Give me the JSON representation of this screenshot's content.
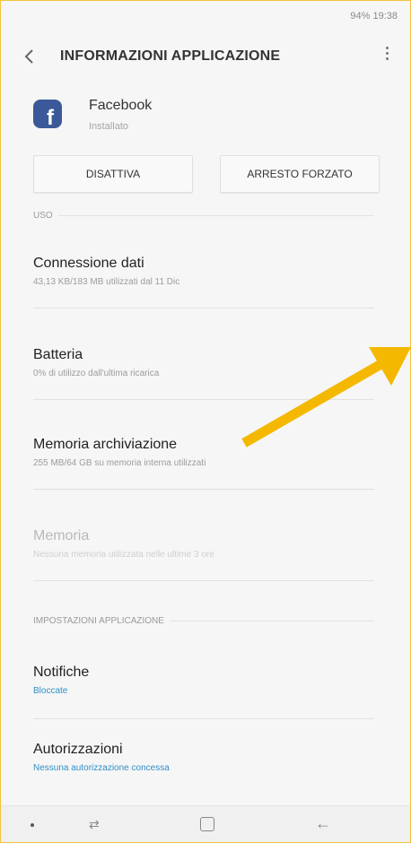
{
  "status_bar": {
    "text": "94% 19:38"
  },
  "app_bar": {
    "title": "INFORMAZIONI APPLICAZIONE",
    "back_icon": "chevron-left-icon",
    "menu_icon": "more-vertical-icon"
  },
  "app": {
    "name": "Facebook",
    "status": "Installato",
    "icon": "facebook-icon",
    "brand_color": "#3b5998"
  },
  "buttons": {
    "disable": "DISATTIVA",
    "force_stop": "ARRESTO FORZATO"
  },
  "sections": {
    "usage_header": "USO",
    "app_settings_header": "IMPOSTAZIONI APPLICAZIONE"
  },
  "usage_items": [
    {
      "title": "Connessione dati",
      "subtitle": "43,13 KB/183 MB utilizzati dal 11 Dic"
    },
    {
      "title": "Batteria",
      "subtitle": "0% di utilizzo dall'ultima ricarica"
    },
    {
      "title": "Memoria archiviazione",
      "subtitle": "255 MB/64 GB su memoria interna utilizzati"
    },
    {
      "title": "Memoria",
      "subtitle": "Nessuna memoria utilizzata nelle ultime 3 ore"
    }
  ],
  "settings_items": [
    {
      "title": "Notifiche",
      "subtitle": "Bloccate"
    },
    {
      "title": "Autorizzazioni",
      "subtitle": "Nessuna autorizzazione concessa"
    }
  ],
  "annotation": {
    "arrow_color": "#f5b800"
  },
  "colors": {
    "accent_blue": "#2f8fc6",
    "frame_border": "#f2c23a"
  }
}
